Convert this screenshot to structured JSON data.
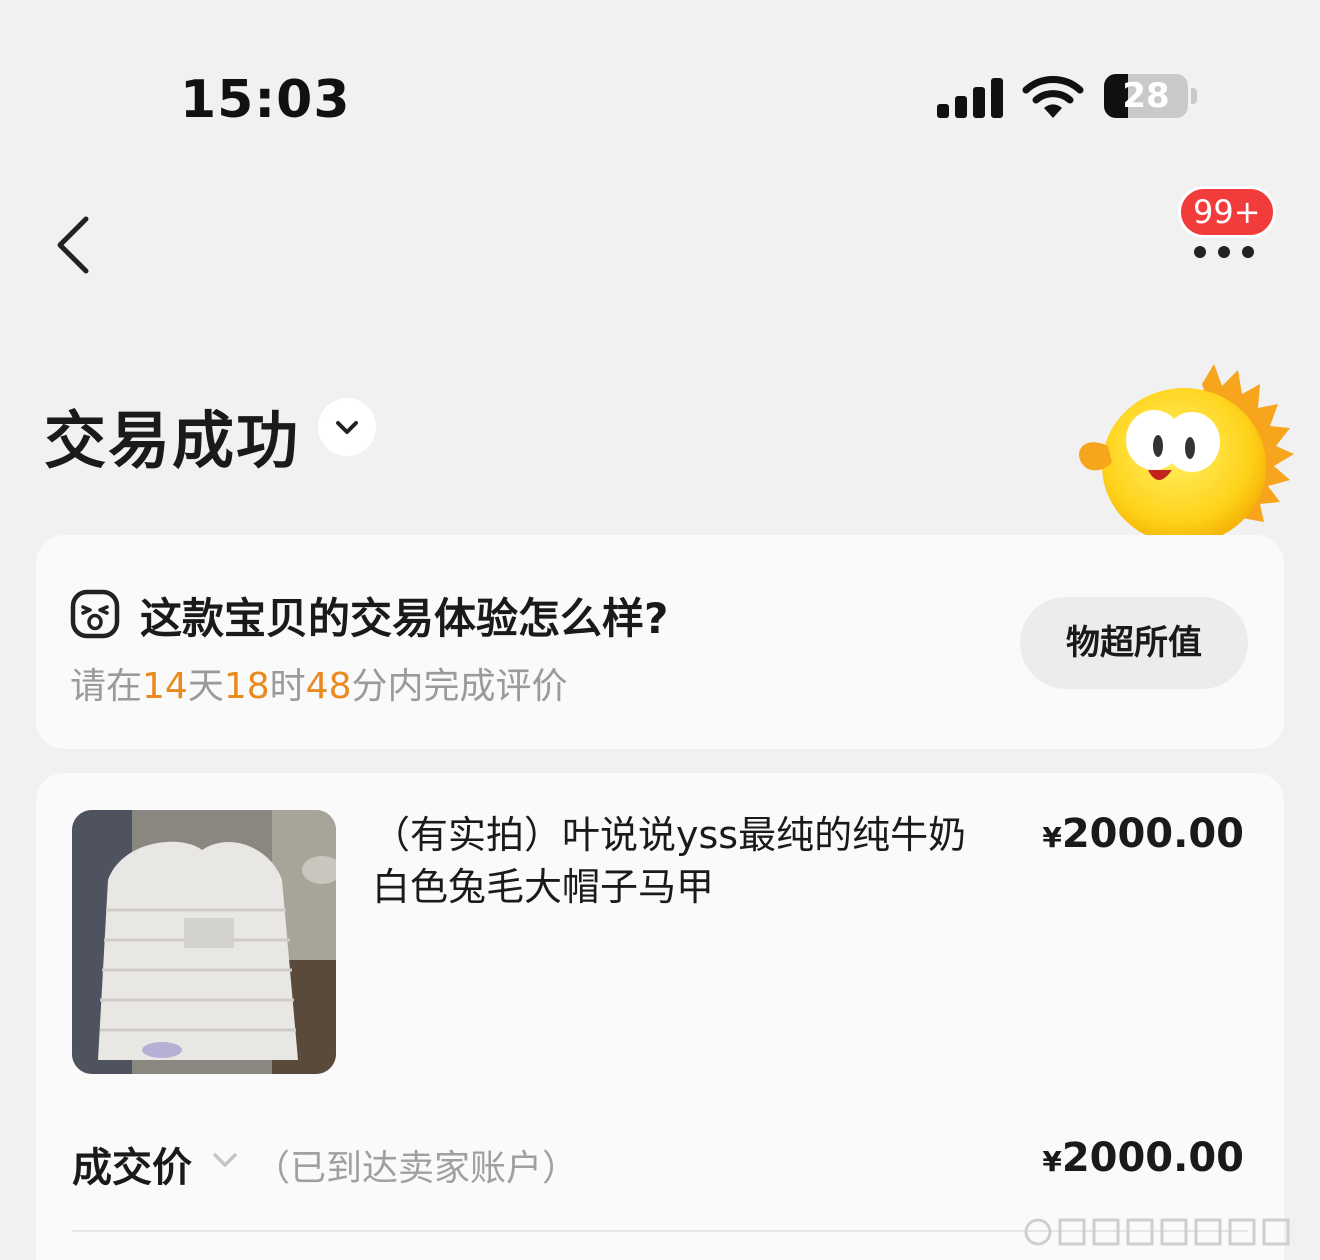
{
  "status_bar": {
    "time": "15:03",
    "battery_level": "28",
    "battery_fraction": 0.28,
    "icons": [
      "signal-icon",
      "wifi-icon",
      "battery-icon"
    ]
  },
  "nav": {
    "back_icon": "chevron-left-icon",
    "more_icon": "more-dots-icon",
    "badge": "99+"
  },
  "header": {
    "title": "交易成功",
    "dropdown_icon": "chevron-down-icon"
  },
  "review": {
    "question": "这款宝贝的交易体验怎么样?",
    "deadline": {
      "prefix": "请在",
      "days": "14",
      "days_unit": "天",
      "hours": "18",
      "hours_unit": "时",
      "minutes": "48",
      "suffix": "分内完成评价"
    },
    "rate_button": "物超所值"
  },
  "order": {
    "product_name": "（有实拍）叶说说yss最纯的纯牛奶 白色兔毛大帽子马甲",
    "currency": "¥",
    "product_price": "2000.00",
    "deal_label": "成交价",
    "deal_note": "（已到达卖家账户）",
    "deal_price": "2000.00"
  },
  "colors": {
    "background": "#f1f1f1",
    "card": "#fafafa",
    "badge": "#f23b3b",
    "countdown": "#e98a1f",
    "muted_text": "#9a9a9a",
    "mascot": "#ffd21a"
  }
}
